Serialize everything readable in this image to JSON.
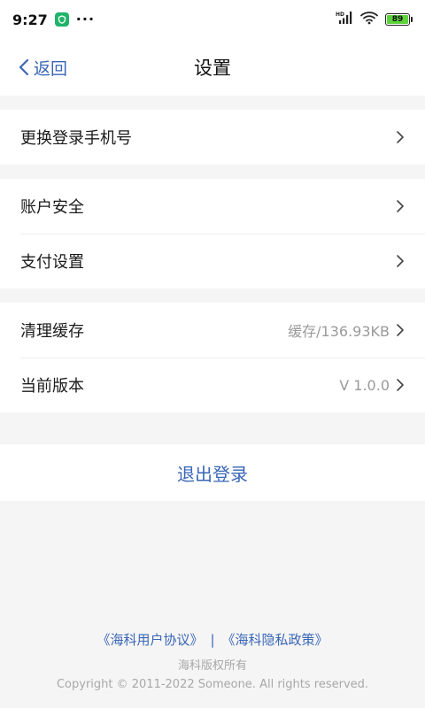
{
  "status_bar": {
    "time": "9:27",
    "dots": "···",
    "battery": "89"
  },
  "nav": {
    "back_label": "返回",
    "title": "设置"
  },
  "groups": [
    {
      "items": [
        {
          "label": "更换登录手机号",
          "value": ""
        }
      ]
    },
    {
      "items": [
        {
          "label": "账户安全",
          "value": ""
        },
        {
          "label": "支付设置",
          "value": ""
        }
      ]
    },
    {
      "items": [
        {
          "label": "清理缓存",
          "value": "缓存/136.93KB"
        },
        {
          "label": "当前版本",
          "value": "V 1.0.0"
        }
      ]
    }
  ],
  "logout_label": "退出登录",
  "footer": {
    "user_agreement": "《海科用户协议》",
    "separator": "|",
    "privacy_policy": "《海科隐私政策》",
    "rights": "海科版权所有",
    "copyright": "Copyright © 2011-2022 Someone. All rights reserved."
  },
  "colors": {
    "accent": "#3a66b6",
    "background": "#f5f5f5",
    "battery": "#5ed23c"
  }
}
